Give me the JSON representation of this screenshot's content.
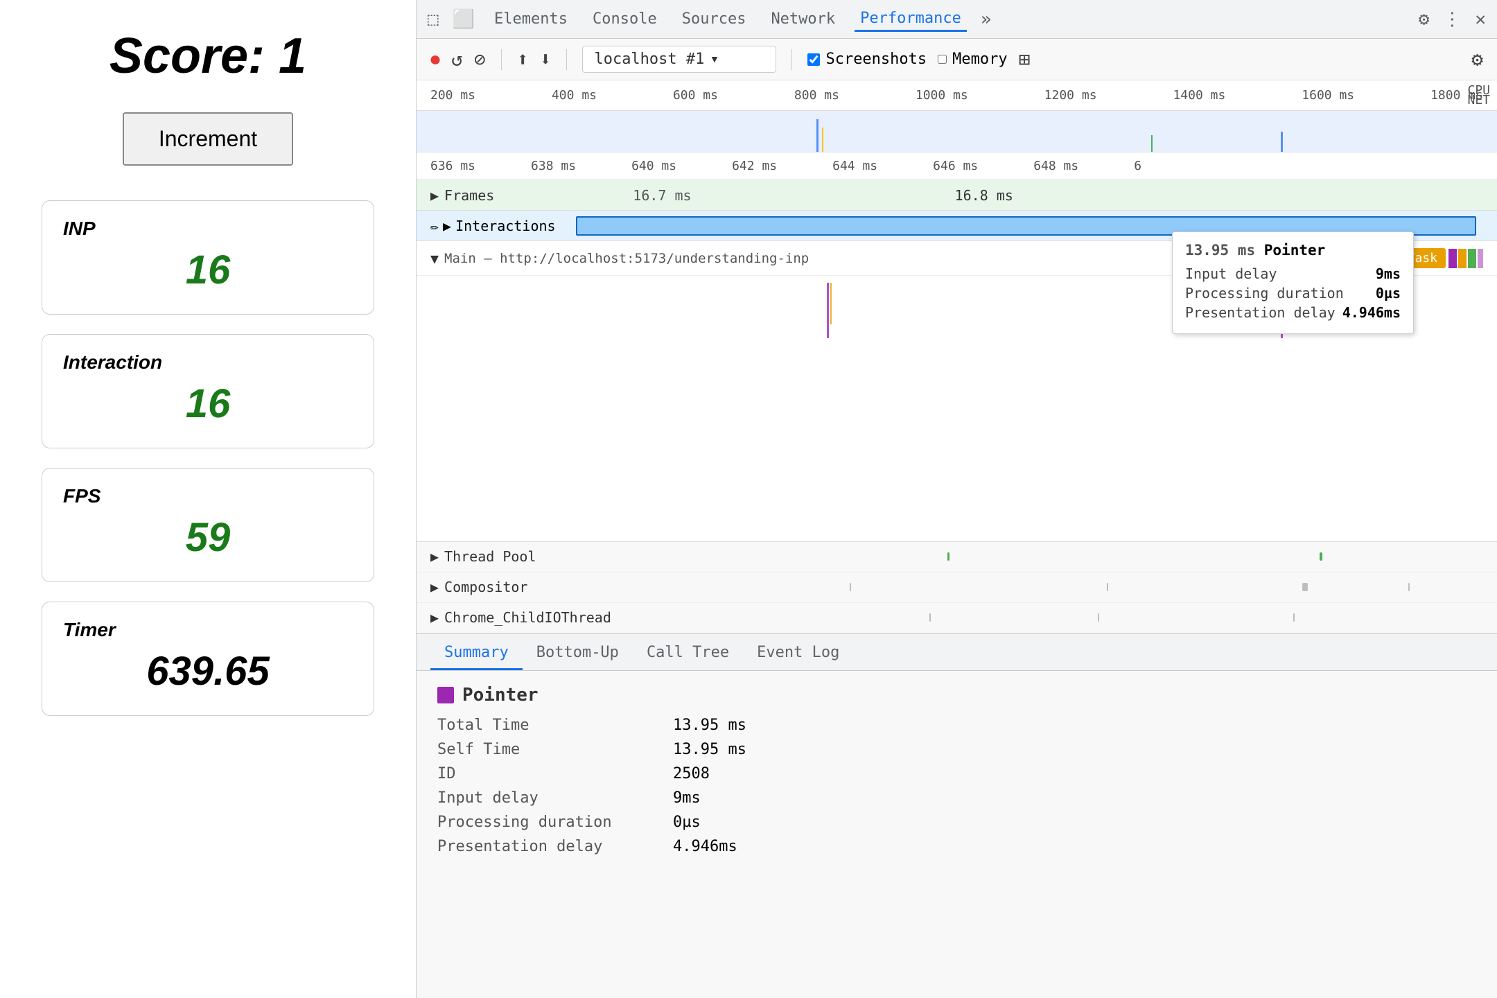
{
  "left": {
    "score_label": "Score:",
    "score_value": "1",
    "increment_button": "Increment",
    "metrics": [
      {
        "label": "INP",
        "value": "16",
        "style": "green"
      },
      {
        "label": "Interaction",
        "value": "16",
        "style": "green"
      },
      {
        "label": "FPS",
        "value": "59",
        "style": "green"
      },
      {
        "label": "Timer",
        "value": "639.65",
        "style": "black"
      }
    ]
  },
  "devtools": {
    "tabs": [
      "Elements",
      "Console",
      "Sources",
      "Network",
      "Performance"
    ],
    "active_tab": "Performance",
    "toolbar": {
      "url": "localhost #1",
      "screenshots_label": "Screenshots",
      "memory_label": "Memory"
    },
    "ruler": {
      "ticks": [
        "200 ms",
        "400 ms",
        "600 ms",
        "800 ms",
        "1000 ms",
        "1200 ms",
        "1400 ms",
        "1600 ms",
        "1800 ms"
      ],
      "cpu_label": "CPU",
      "net_label": "NET"
    },
    "detail_ruler": {
      "ticks": [
        "636 ms",
        "638 ms",
        "640 ms",
        "642 ms",
        "644 ms",
        "646 ms",
        "648 ms",
        "6"
      ]
    },
    "frames": {
      "label": "Frames",
      "timing1": "16.7 ms",
      "timing2": "16.8 ms"
    },
    "interactions": {
      "label": "Interactions",
      "edit_icon": "✏"
    },
    "tooltip": {
      "time": "13.95 ms",
      "type": "Pointer",
      "input_delay_label": "Input delay",
      "input_delay_value": "9ms",
      "processing_label": "Processing duration",
      "processing_value": "0µs",
      "presentation_label": "Presentation delay",
      "presentation_value": "4.946ms"
    },
    "main_thread": {
      "label": "Main — http://localhost:5173/understanding-inp",
      "task_label": "Task"
    },
    "threads": [
      {
        "label": "Thread Pool",
        "has_bars": true
      },
      {
        "label": "Compositor",
        "has_bars": true
      },
      {
        "label": "Chrome_ChildIOThread",
        "has_bars": true
      }
    ],
    "bottom_tabs": [
      "Summary",
      "Bottom-Up",
      "Call Tree",
      "Event Log"
    ],
    "active_bottom_tab": "Summary",
    "summary": {
      "type_color": "#9c27b0",
      "type_label": "Pointer",
      "rows": [
        {
          "label": "Total Time",
          "value": "13.95 ms"
        },
        {
          "label": "Self Time",
          "value": "13.95 ms"
        },
        {
          "label": "ID",
          "value": "2508"
        },
        {
          "label": "Input delay",
          "value": "9ms"
        },
        {
          "label": "Processing duration",
          "value": "0µs"
        },
        {
          "label": "Presentation delay",
          "value": "4.946ms"
        }
      ]
    }
  }
}
